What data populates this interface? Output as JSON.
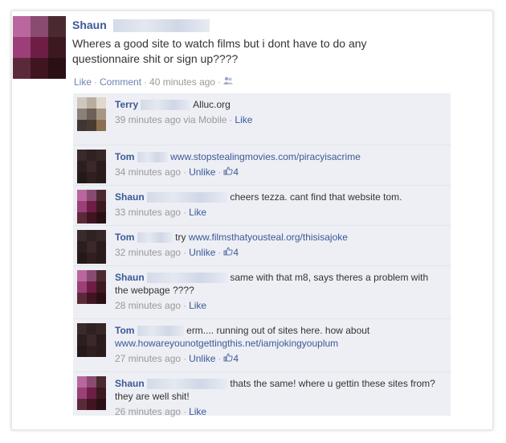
{
  "post": {
    "author": "Shaun",
    "text": "Wheres a good site to watch films but i dont have to do any questionnaire shit or sign up????",
    "like_label": "Like",
    "comment_label": "Comment",
    "time": "40 minutes ago",
    "separator": "·"
  },
  "comments": [
    {
      "author": "Terry",
      "text": "Alluc.org",
      "time": "39 minutes ago via Mobile",
      "action": "Like",
      "likes": ""
    },
    {
      "author": "Tom",
      "text": "www.stopstealingmovies.com/piracyisacrime",
      "time": "34 minutes ago",
      "action": "Unlike",
      "likes": "4"
    },
    {
      "author": "Shaun",
      "text": "cheers tezza. cant find that website tom.",
      "time": "33 minutes ago",
      "action": "Like",
      "likes": ""
    },
    {
      "author": "Tom",
      "text_prefix": "try",
      "text": "www.filmsthatyousteal.org/thisisajoke",
      "time": "32 minutes ago",
      "action": "Unlike",
      "likes": "4"
    },
    {
      "author": "Shaun",
      "text": "same with that m8, says theres a problem with the webpage ????",
      "time": "28 minutes ago",
      "action": "Like",
      "likes": ""
    },
    {
      "author": "Tom",
      "text_prefix": "erm.... running out of sites here. how about",
      "text": "www.howareyounotgettingthis.net/iamjokingyouplum",
      "time": "27 minutes ago",
      "action": "Unlike",
      "likes": "4"
    },
    {
      "author": "Shaun",
      "text": "thats the same! where u gettin these sites from? they are well shit!",
      "time": "26 minutes ago",
      "action": "Like",
      "likes": ""
    }
  ],
  "colors": {
    "link": "#3b5998",
    "muted": "#999999",
    "comment_bg": "#edeff4"
  },
  "icons": [
    "friends-icon",
    "thumbs-up-icon"
  ]
}
